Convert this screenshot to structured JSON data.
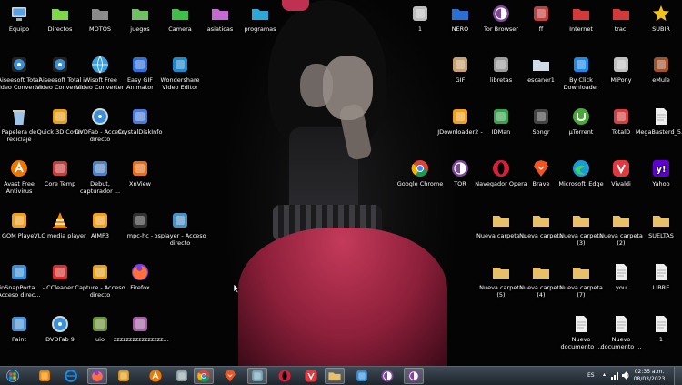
{
  "desktop": {
    "icons": [
      {
        "id": "equipo",
        "label": "Equipo",
        "icon": "computer-icon",
        "color": "#5aa0e0"
      },
      {
        "id": "directos",
        "label": "Directos",
        "icon": "folder-icon",
        "color": "#7fd54a"
      },
      {
        "id": "motos",
        "label": "MOTOS",
        "icon": "folder-icon",
        "color": "#8a8a8a"
      },
      {
        "id": "juegos",
        "label": "juegos",
        "icon": "folder-icon",
        "color": "#6fbf63"
      },
      {
        "id": "camera",
        "label": "Camera",
        "icon": "folder-icon",
        "color": "#3fbf4a"
      },
      {
        "id": "asiaticas",
        "label": "asiaticas",
        "icon": "folder-icon",
        "color": "#c56ad3"
      },
      {
        "id": "programas",
        "label": "programas",
        "icon": "folder-icon",
        "color": "#2fa7d8"
      },
      {
        "id": "one",
        "label": "1",
        "icon": "phone-icon",
        "color": "#bdbdbd"
      },
      {
        "id": "nero",
        "label": "NERO",
        "icon": "folder-icon",
        "color": "#2a6fd6"
      },
      {
        "id": "torbrowser",
        "label": "Tor Browser",
        "icon": "tor-icon",
        "color": "#7d4698"
      },
      {
        "id": "ff",
        "label": "ff",
        "icon": "image-file-icon",
        "color": "#c04040"
      },
      {
        "id": "internet",
        "label": "Internet",
        "icon": "folder-icon",
        "color": "#d43a3a"
      },
      {
        "id": "traci",
        "label": "traci",
        "icon": "folder-icon",
        "color": "#d43a3a"
      },
      {
        "id": "subir",
        "label": "SUBIR",
        "icon": "star-icon",
        "color": "#f2c21b"
      },
      {
        "id": "aiseesoft1",
        "label": "Aiseesoft Total Video Converter",
        "icon": "film-reel-icon",
        "color": "#3a8fd6"
      },
      {
        "id": "aiseesoft2",
        "label": "Aiseesoft Total Video Converter",
        "icon": "film-reel-icon",
        "color": "#3a8fd6"
      },
      {
        "id": "iwisoft",
        "label": "iWisoft Free Video Converter",
        "icon": "globe-icon",
        "color": "#3aa0e0"
      },
      {
        "id": "easygif",
        "label": "Easy GIF Animator",
        "icon": "gif-icon",
        "color": "#2f6fd6"
      },
      {
        "id": "wondershare",
        "label": "Wondershare Video Editor",
        "icon": "clapper-icon",
        "color": "#1e88c8"
      },
      {
        "id": "gif",
        "label": "GIF",
        "icon": "picture-icon",
        "color": "#c8a070"
      },
      {
        "id": "libretas",
        "label": "libretas",
        "icon": "box-icon",
        "color": "#9a9a9a"
      },
      {
        "id": "escaner",
        "label": "escaner1",
        "icon": "folder-icon",
        "color": "#d0dbe8"
      },
      {
        "id": "byclick",
        "label": "By Click Downloader",
        "icon": "download-icon",
        "color": "#1e88e5"
      },
      {
        "id": "mipony",
        "label": "MiPony",
        "icon": "mipony-icon",
        "color": "#c0c0c0"
      },
      {
        "id": "emule",
        "label": "eMule",
        "icon": "emule-icon",
        "color": "#a0522d"
      },
      {
        "id": "papelera",
        "label": "Papelera de reciclaje",
        "icon": "recycle-bin-icon",
        "color": "#9fc4e8"
      },
      {
        "id": "quick3d",
        "label": "Quick 3D Cover",
        "icon": "cube-icon",
        "color": "#e0a020"
      },
      {
        "id": "dvdfab",
        "label": "DVDFab - Acceso directo",
        "icon": "disc-icon",
        "color": "#3a8fd6"
      },
      {
        "id": "crystaldisk",
        "label": "CrystalDiskInfo",
        "icon": "crystal-icon",
        "color": "#4a7ad6"
      },
      {
        "id": "jdownloader",
        "label": "JDownloader2 -",
        "icon": "jdownloader-icon",
        "color": "#f0a020"
      },
      {
        "id": "idman",
        "label": "IDMan",
        "icon": "idm-icon",
        "color": "#3aa050"
      },
      {
        "id": "songr",
        "label": "Songr",
        "icon": "music-icon",
        "color": "#444"
      },
      {
        "id": "utorrent",
        "label": "µTorrent",
        "icon": "utorrent-icon",
        "color": "#4aa83a"
      },
      {
        "id": "totald",
        "label": "TotalD",
        "icon": "totald-icon",
        "color": "#d04040"
      },
      {
        "id": "megabasterd",
        "label": "MegaBasterd_5...",
        "icon": "text-file-icon",
        "color": "#eee"
      },
      {
        "id": "avast",
        "label": "Avast Free Antivirus",
        "icon": "avast-icon",
        "color": "#f07800"
      },
      {
        "id": "coretemp",
        "label": "Core Temp",
        "icon": "thermometer-icon",
        "color": "#c04040"
      },
      {
        "id": "debut",
        "label": "Debut, capturador ...",
        "icon": "video-capture-icon",
        "color": "#5080c0"
      },
      {
        "id": "xnview",
        "label": "XnView",
        "icon": "xnview-icon",
        "color": "#e07020"
      },
      {
        "id": "chrome",
        "label": "Google Chrome",
        "icon": "chrome-icon",
        "color": "#db4437"
      },
      {
        "id": "tor",
        "label": "TOR",
        "icon": "tor-icon",
        "color": "#7d4698"
      },
      {
        "id": "opera",
        "label": "Navegador Opera",
        "icon": "opera-icon",
        "color": "#d6203a"
      },
      {
        "id": "brave",
        "label": "Brave",
        "icon": "brave-icon",
        "color": "#f05423"
      },
      {
        "id": "edge",
        "label": "Microsoft_Edge",
        "icon": "edge-icon",
        "color": "#1c9ad6"
      },
      {
        "id": "vivaldi",
        "label": "Vivaldi",
        "icon": "vivaldi-icon",
        "color": "#e0393e"
      },
      {
        "id": "yahoo",
        "label": "Yahoo",
        "icon": "yahoo-icon",
        "color": "#6001d2"
      },
      {
        "id": "gom",
        "label": "GOM Player",
        "icon": "gom-icon",
        "color": "#f0a020"
      },
      {
        "id": "vlc",
        "label": "VLC media player",
        "icon": "vlc-icon",
        "color": "#f08c00"
      },
      {
        "id": "aimp",
        "label": "AIMP3",
        "icon": "aimp-icon",
        "color": "#f0a020"
      },
      {
        "id": "mpchc",
        "label": "mpc-hc -",
        "icon": "mpc-icon",
        "color": "#333"
      },
      {
        "id": "bsplayer",
        "label": "bsplayer - Acceso directo",
        "icon": "bsplayer-icon",
        "color": "#4a90c0"
      },
      {
        "id": "nc_u",
        "label": "Nueva carpeta u",
        "icon": "folder-icon",
        "color": "#e8c06a"
      },
      {
        "id": "nc",
        "label": "Nueva carpeta",
        "icon": "folder-icon",
        "color": "#e8c06a"
      },
      {
        "id": "nc3",
        "label": "Nueva carpeta (3)",
        "icon": "folder-icon",
        "color": "#e8c06a"
      },
      {
        "id": "nc2",
        "label": "Nueva carpeta (2)",
        "icon": "folder-icon",
        "color": "#e8c06a"
      },
      {
        "id": "sueltas",
        "label": "SUELTAS",
        "icon": "folder-icon",
        "color": "#e8c06a"
      },
      {
        "id": "winsnap",
        "label": "WinSnapPorta... - Acceso direc...",
        "icon": "winsnap-icon",
        "color": "#3a8fd6"
      },
      {
        "id": "ccleaner",
        "label": "CCleaner",
        "icon": "ccleaner-icon",
        "color": "#d03030"
      },
      {
        "id": "capture",
        "label": "Capture - Acceso directo",
        "icon": "capture-icon",
        "color": "#e0a020"
      },
      {
        "id": "firefox",
        "label": "Firefox",
        "icon": "firefox-icon",
        "color": "#ff7139"
      },
      {
        "id": "nc5",
        "label": "Nueva carpeta (5)",
        "icon": "folder-icon",
        "color": "#e8c06a"
      },
      {
        "id": "nc4",
        "label": "Nueva carpeta (4)",
        "icon": "folder-icon",
        "color": "#e8c06a"
      },
      {
        "id": "nc7",
        "label": "Nueva carpeta (7)",
        "icon": "folder-icon",
        "color": "#e8c06a"
      },
      {
        "id": "you",
        "label": "you",
        "icon": "text-file-icon",
        "color": "#eee"
      },
      {
        "id": "libre",
        "label": "LIBRE",
        "icon": "text-file-icon",
        "color": "#eee"
      },
      {
        "id": "paint",
        "label": "Paint",
        "icon": "paint-icon",
        "color": "#4a90d0"
      },
      {
        "id": "dvdfab9",
        "label": "DVDFab 9",
        "icon": "disc-icon",
        "color": "#3a8fd6"
      },
      {
        "id": "uio",
        "label": "uio",
        "icon": "minecraft-icon",
        "color": "#6b8e3a"
      },
      {
        "id": "zzz",
        "label": "zzzzzzzzzzzzzzzz...",
        "icon": "photo-icon",
        "color": "#a060a0"
      },
      {
        "id": "nuevodoc1",
        "label": "Nuevo documento ...",
        "icon": "text-file-icon",
        "color": "#eee"
      },
      {
        "id": "nuevodoc2",
        "label": "Nuevo documento ...",
        "icon": "text-file-icon",
        "color": "#eee"
      },
      {
        "id": "doc1",
        "label": "1",
        "icon": "text-file-icon",
        "color": "#eee"
      }
    ]
  },
  "taskbar": {
    "items": [
      {
        "id": "start",
        "icon": "windows-start-icon",
        "color": "#3a8fd6",
        "active": false
      },
      {
        "id": "pinned-orb",
        "icon": "orange-orb-icon",
        "color": "#f08c00",
        "active": false
      },
      {
        "id": "ie",
        "icon": "internet-explorer-icon",
        "color": "#1e88e5",
        "active": false
      },
      {
        "id": "firefox",
        "icon": "firefox-icon",
        "color": "#ff7139",
        "active": true
      },
      {
        "id": "media",
        "icon": "media-player-icon",
        "color": "#e0a020",
        "active": false
      },
      {
        "id": "avast",
        "icon": "avast-icon",
        "color": "#f07800",
        "active": false
      },
      {
        "id": "app",
        "icon": "swirl-icon",
        "color": "#9aa",
        "active": false
      },
      {
        "id": "chrome",
        "icon": "chrome-icon",
        "color": "#db4437",
        "active": true
      },
      {
        "id": "brave",
        "icon": "brave-icon",
        "color": "#f05423",
        "active": false
      },
      {
        "id": "window",
        "icon": "window-icon",
        "color": "#7ab",
        "active": true
      },
      {
        "id": "opera",
        "icon": "opera-icon",
        "color": "#d6203a",
        "active": false
      },
      {
        "id": "vivaldi",
        "icon": "vivaldi-icon",
        "color": "#e0393e",
        "active": false
      },
      {
        "id": "explorer",
        "icon": "folder-icon",
        "color": "#e8c06a",
        "active": true
      },
      {
        "id": "tool",
        "icon": "tool-icon",
        "color": "#3a8fd6",
        "active": false
      },
      {
        "id": "tor1",
        "icon": "tor-icon",
        "color": "#7d4698",
        "active": false
      },
      {
        "id": "tor2",
        "icon": "tor-icon",
        "color": "#7d4698",
        "active": true
      }
    ],
    "language": "ES",
    "time": "02:35 a.m.",
    "date": "08/03/2023"
  }
}
